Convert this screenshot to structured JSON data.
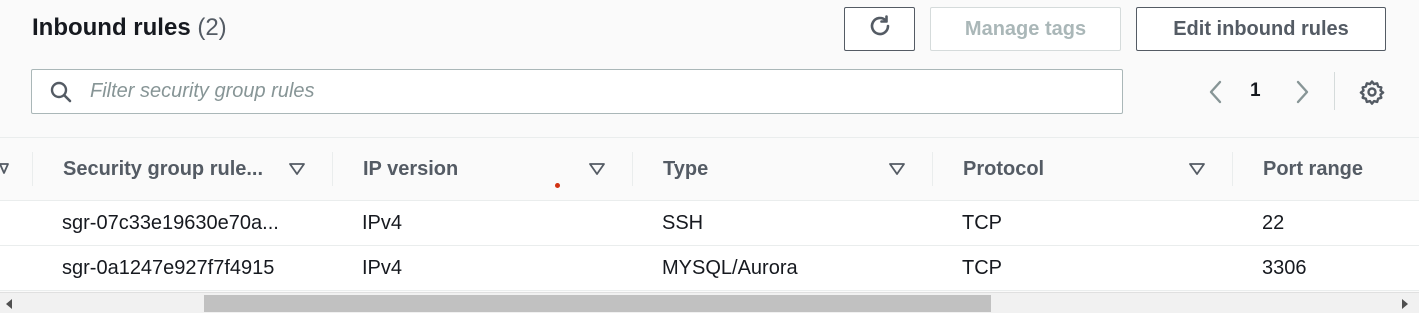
{
  "header": {
    "title": "Inbound rules",
    "count": "(2)"
  },
  "toolbar": {
    "refresh_icon": "refresh-icon",
    "manage_tags_label": "Manage tags",
    "edit_inbound_rules_label": "Edit inbound rules"
  },
  "search": {
    "placeholder": "Filter security group rules",
    "value": ""
  },
  "pagination": {
    "current_page": "1",
    "prev_icon": "chevron-left-icon",
    "next_icon": "chevron-right-icon",
    "settings_icon": "gear-icon"
  },
  "table": {
    "columns": [
      {
        "label": "Security group rule..."
      },
      {
        "label": "IP version"
      },
      {
        "label": "Type"
      },
      {
        "label": "Protocol"
      },
      {
        "label": "Port range"
      }
    ],
    "rows": [
      {
        "rule_id": "sgr-07c33e19630e70a...",
        "ip_version": "IPv4",
        "type": "SSH",
        "protocol": "TCP",
        "port_range": "22"
      },
      {
        "rule_id": "sgr-0a1247e927f7f4915",
        "ip_version": "IPv4",
        "type": "MYSQL/Aurora",
        "protocol": "TCP",
        "port_range": "3306"
      }
    ]
  },
  "colors": {
    "text_primary": "#16191f",
    "text_secondary": "#545b64",
    "disabled": "#aab7b8",
    "border": "#eaeded"
  }
}
